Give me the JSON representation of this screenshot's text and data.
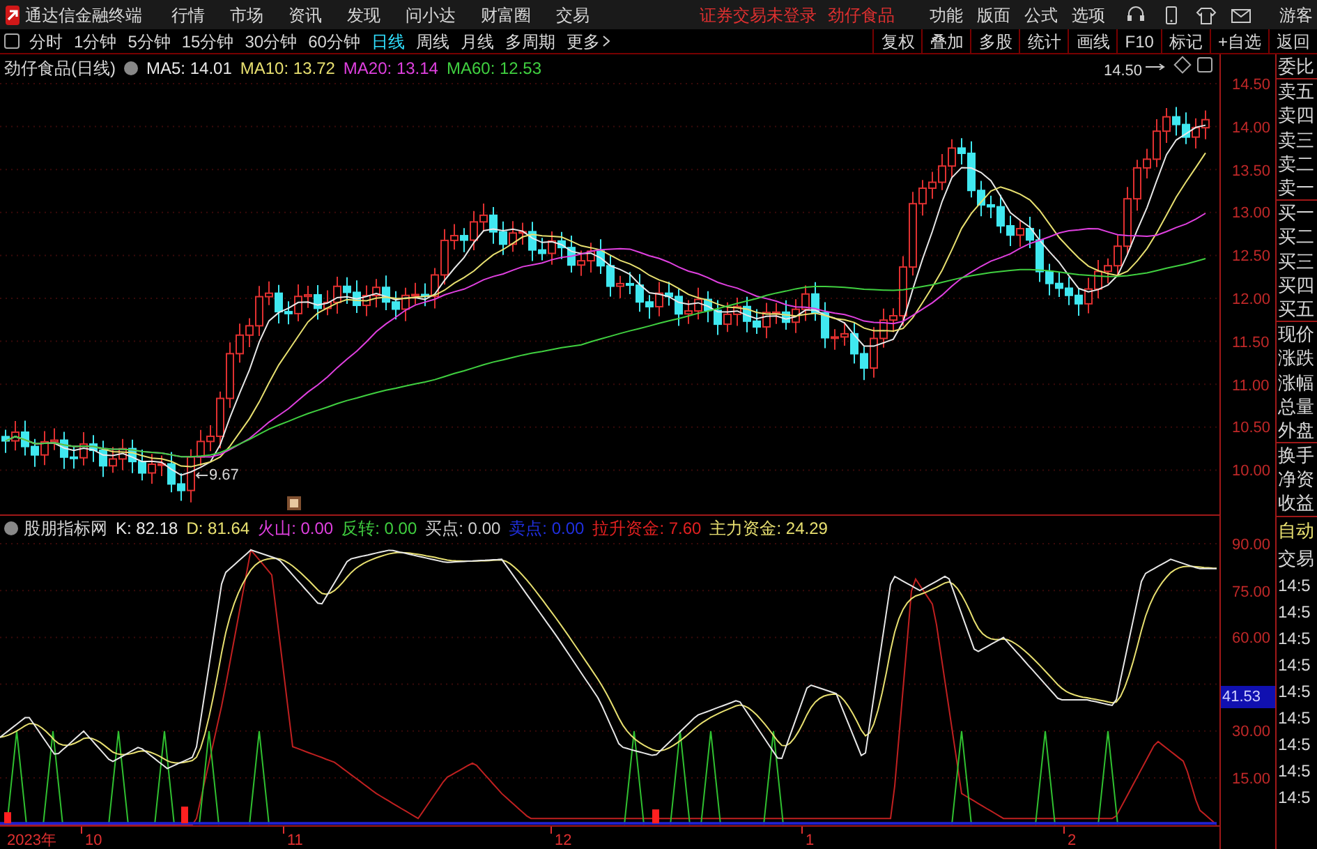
{
  "app_title": "通达信金融终端",
  "menu": [
    "行情",
    "市场",
    "资讯",
    "发现",
    "问小达",
    "财富圈",
    "交易"
  ],
  "notice": "证券交易未登录",
  "stock_name": "劲仔食品",
  "right_menu": [
    "功能",
    "版面",
    "公式",
    "选项"
  ],
  "user": "游客",
  "periods": [
    {
      "label": "分时",
      "selected": false
    },
    {
      "label": "1分钟",
      "selected": false
    },
    {
      "label": "5分钟",
      "selected": false
    },
    {
      "label": "15分钟",
      "selected": false
    },
    {
      "label": "30分钟",
      "selected": false
    },
    {
      "label": "60分钟",
      "selected": false
    },
    {
      "label": "日线",
      "selected": true
    },
    {
      "label": "周线",
      "selected": false
    },
    {
      "label": "月线",
      "selected": false
    },
    {
      "label": "多周期",
      "selected": false
    },
    {
      "label": "更多",
      "selected": false
    }
  ],
  "tools": [
    "复权",
    "叠加",
    "多股",
    "统计",
    "画线",
    "F10",
    "标记",
    "+自选",
    "返回"
  ],
  "chart_title": "劲仔食品(日线)",
  "ma": [
    {
      "text": "MA5: 14.01",
      "color": "#e8e8e8"
    },
    {
      "text": "MA10: 13.72",
      "color": "#e8e070"
    },
    {
      "text": "MA20: 13.14",
      "color": "#e040e0"
    },
    {
      "text": "MA60: 12.53",
      "color": "#40d040"
    }
  ],
  "price_axis": [
    "14.50",
    "14.00",
    "13.50",
    "13.00",
    "12.50",
    "12.00",
    "11.50",
    "11.00",
    "10.50",
    "10.00"
  ],
  "high_marker": "14.50",
  "low_marker": "9.67",
  "indicator": {
    "name": "股朋指标网",
    "values": [
      {
        "text": "K: 82.18",
        "color": "#e8e8e8"
      },
      {
        "text": "D: 81.64",
        "color": "#e8e070"
      },
      {
        "text": "火山: 0.00",
        "color": "#e040e0"
      },
      {
        "text": "反转: 0.00",
        "color": "#40d040"
      },
      {
        "text": "买点: 0.00",
        "color": "#d0d0d0"
      },
      {
        "text": "卖点: 0.00",
        "color": "#2030e0"
      },
      {
        "text": "拉升资金: 7.60",
        "color": "#e02020"
      },
      {
        "text": "主力资金: 24.29",
        "color": "#e8e070"
      }
    ]
  },
  "indicator_axis": [
    "90.00",
    "75.00",
    "60.00",
    "30.00",
    "15.00"
  ],
  "current_value": "41.53",
  "side_labels": [
    "委比",
    "卖五",
    "卖四",
    "卖三",
    "卖二",
    "卖一",
    "买一",
    "买二",
    "买三",
    "买四",
    "买五",
    "现价",
    "涨跌",
    "涨幅",
    "总量",
    "外盘",
    "换手",
    "净资",
    "收益"
  ],
  "side_buttons": [
    "自动",
    "交易"
  ],
  "trade_times": [
    "14:5",
    "14:5",
    "14:5",
    "14:5",
    "14:5",
    "14:5",
    "14:5",
    "14:5",
    "14:5"
  ],
  "time_axis": [
    "2023年",
    "10",
    "11",
    "12",
    "1",
    "2"
  ]
}
